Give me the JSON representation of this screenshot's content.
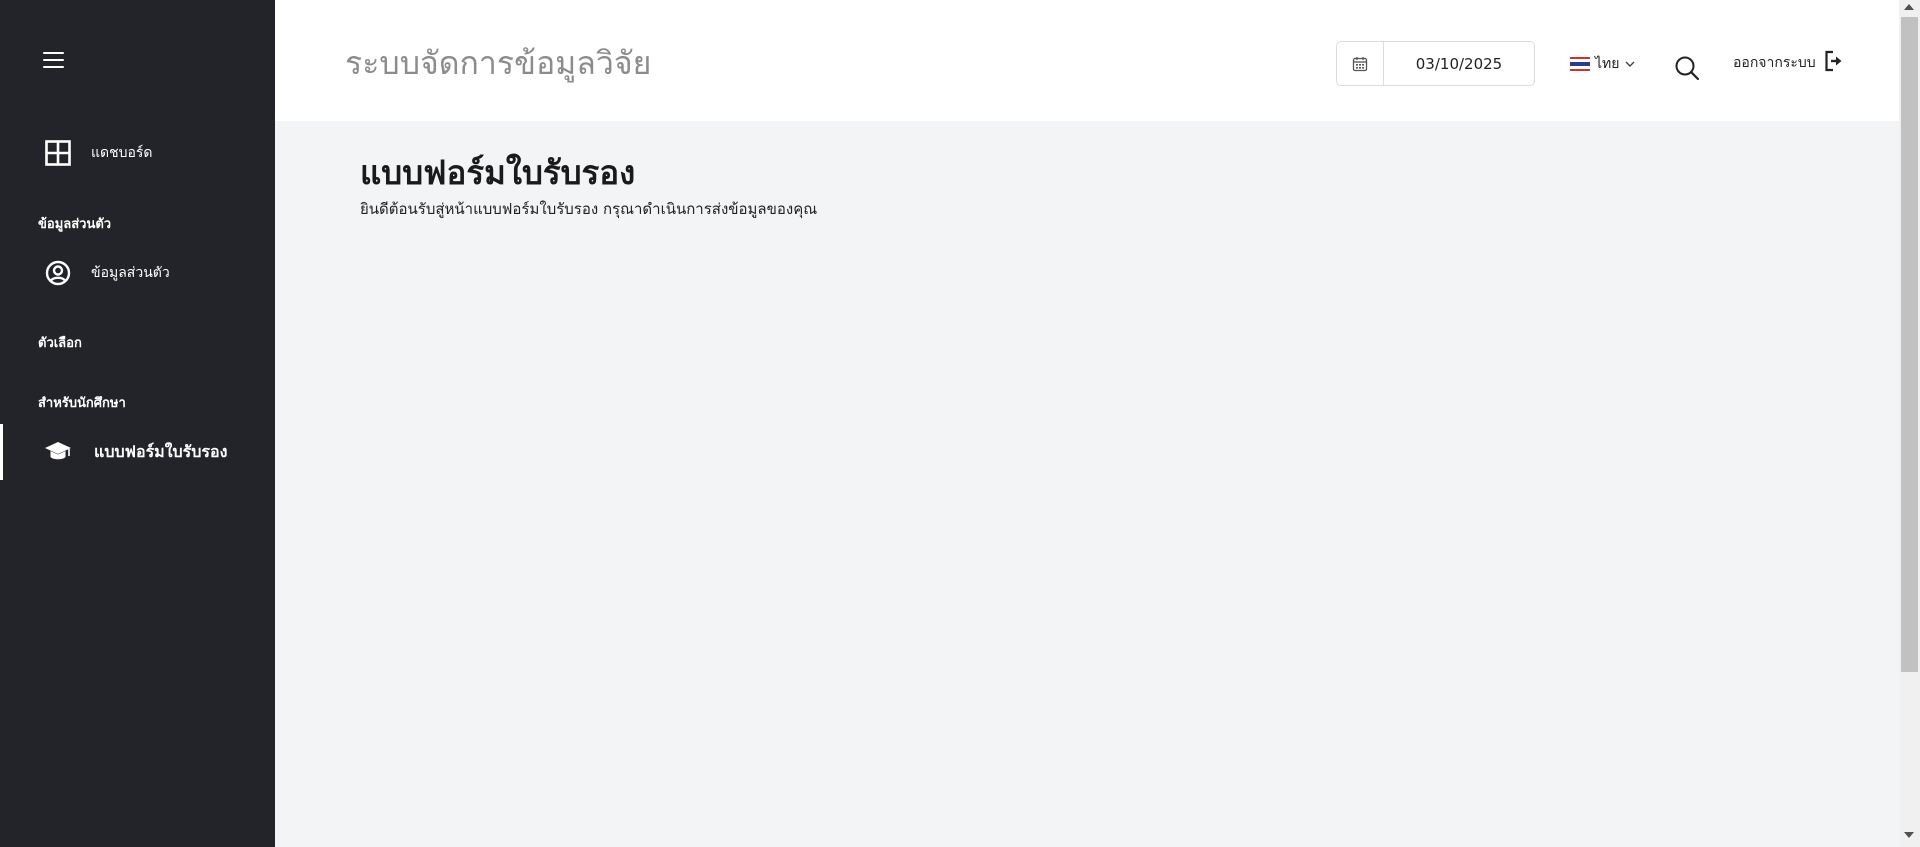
{
  "sidebar": {
    "items": {
      "dashboard": {
        "label": "แดชบอร์ด",
        "icon": "grid-icon"
      },
      "profile": {
        "label": "ข้อมูลส่วนตัว",
        "icon": "user-circle-icon"
      },
      "certificate_form": {
        "label": "แบบฟอร์มใบรับรอง",
        "icon": "graduation-cap-icon",
        "active": true
      }
    },
    "sections": {
      "personal": "ข้อมูลส่วนตัว",
      "options": "ตัวเลือก",
      "students": "สำหรับนักศึกษา"
    }
  },
  "header": {
    "app_title": "ระบบจัดการข้อมูลวิจัย",
    "date": "03/10/2025",
    "language": "ไทย",
    "logout_label": "ออกจากระบบ"
  },
  "main": {
    "title": "แบบฟอร์มใบรับรอง",
    "description": "ยินดีต้อนรับสู่หน้าแบบฟอร์มใบรับรอง กรุณาดำเนินการส่งข้อมูลของคุณ"
  },
  "colors": {
    "sidebar_bg": "#232429",
    "main_bg": "#f3f4f6",
    "header_bg": "#ffffff",
    "title_gray": "#8c8c8c"
  }
}
